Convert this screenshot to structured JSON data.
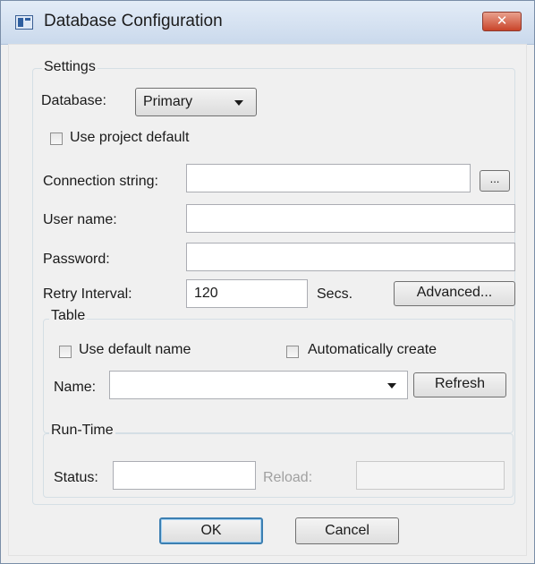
{
  "window": {
    "title": "Database Configuration",
    "close_glyph": "✕"
  },
  "settings": {
    "legend": "Settings",
    "database_label": "Database:",
    "database_value": "Primary",
    "use_project_default_label": "Use project default",
    "connection_string_label": "Connection string:",
    "connection_string_value": "",
    "browse_button": "...",
    "user_name_label": "User name:",
    "user_name_value": "",
    "password_label": "Password:",
    "password_value": "",
    "retry_interval_label": "Retry Interval:",
    "retry_interval_value": "120",
    "retry_units": "Secs.",
    "advanced_button": "Advanced..."
  },
  "table": {
    "legend": "Table",
    "use_default_name_label": "Use default name",
    "auto_create_label": "Automatically create",
    "name_label": "Name:",
    "name_value": "",
    "refresh_button": "Refresh"
  },
  "runtime": {
    "legend": "Run-Time",
    "status_label": "Status:",
    "status_value": "",
    "reload_label": "Reload:",
    "reload_value": ""
  },
  "footer": {
    "ok_button": "OK",
    "cancel_button": "Cancel"
  }
}
